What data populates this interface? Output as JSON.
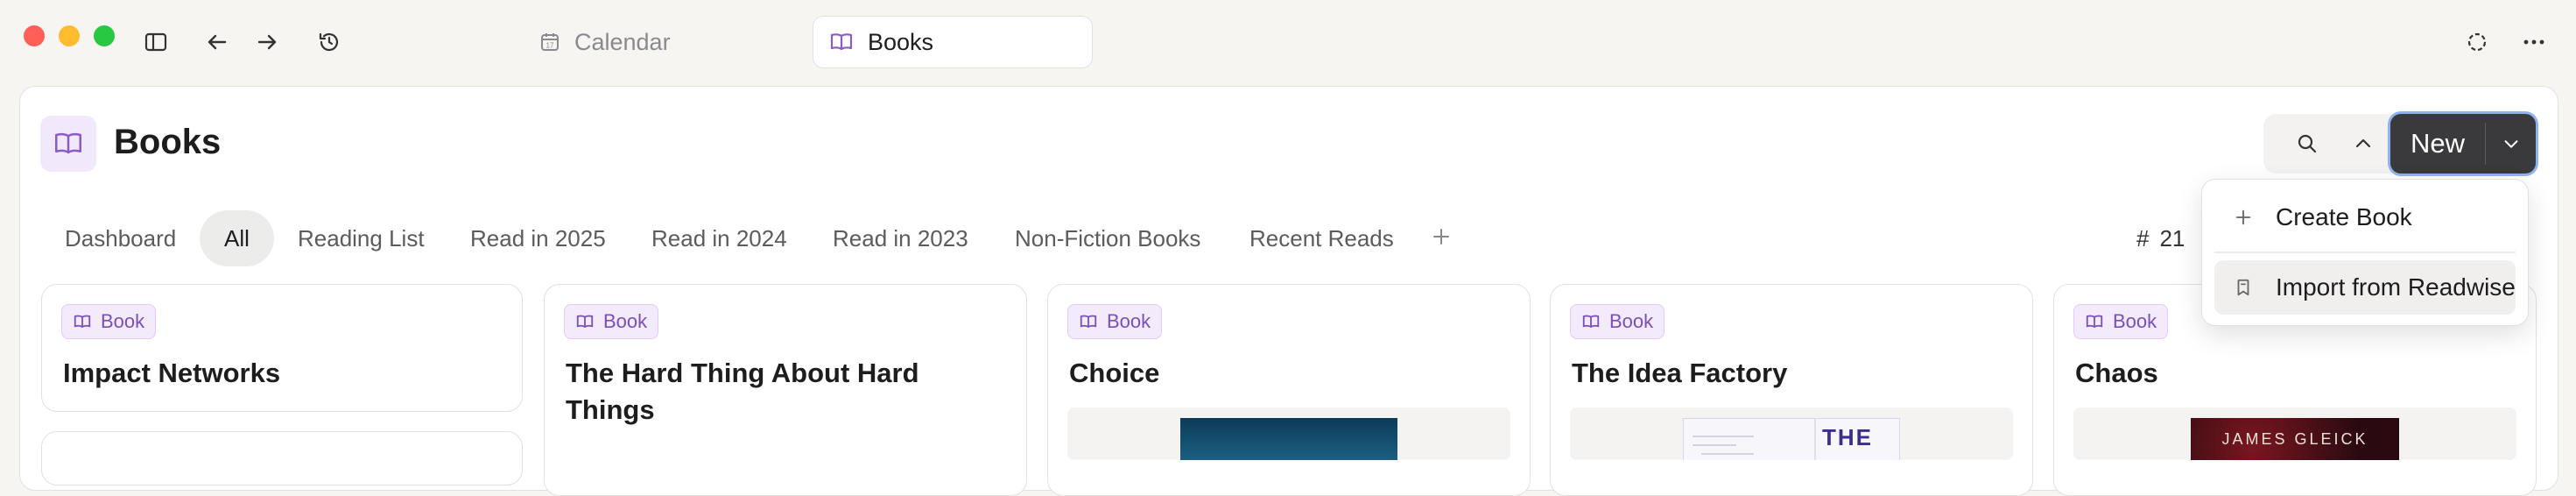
{
  "window": {
    "traffic_colors": [
      "#ff5f57",
      "#febc2e",
      "#28c840"
    ]
  },
  "toolbar": {
    "icons": [
      "sidebar-toggle-icon",
      "back-arrow-icon",
      "forward-arrow-icon",
      "history-icon"
    ],
    "right_icons": [
      "sync-status-icon",
      "more-options-icon"
    ]
  },
  "tabs": [
    {
      "label": "Calendar",
      "icon": "calendar-icon",
      "active": false
    },
    {
      "label": "Books",
      "icon": "book-icon",
      "active": true
    }
  ],
  "page": {
    "title": "Books",
    "icon": "book-icon",
    "accent": "#8a5cc4"
  },
  "actions": {
    "new_label": "New",
    "icons": [
      "search-icon",
      "chevron-up-icon",
      "chevron-down-icon"
    ]
  },
  "views": [
    {
      "label": "Dashboard",
      "active": false
    },
    {
      "label": "All",
      "active": true
    },
    {
      "label": "Reading List",
      "active": false
    },
    {
      "label": "Read in 2025",
      "active": false
    },
    {
      "label": "Read in 2024",
      "active": false
    },
    {
      "label": "Read in 2023",
      "active": false
    },
    {
      "label": "Non-Fiction Books",
      "active": false
    },
    {
      "label": "Recent Reads",
      "active": false
    }
  ],
  "count": {
    "symbol": "#",
    "value": "21"
  },
  "cards": [
    {
      "badge": "Book",
      "title": "Impact Networks",
      "has_cover": false
    },
    {
      "badge": "Book",
      "title": "The Hard Thing About Hard Things",
      "has_cover": false
    },
    {
      "badge": "Book",
      "title": "Choice",
      "has_cover": true
    },
    {
      "badge": "Book",
      "title": "The Idea Factory",
      "has_cover": true
    },
    {
      "badge": "Book",
      "title": "Chaos",
      "has_cover": true
    }
  ],
  "cover_texts": {
    "idea_factory": "THE",
    "chaos": "JAMES GLEICK"
  },
  "dropdown": {
    "items": [
      {
        "label": "Create Book",
        "icon": "plus-icon",
        "highlighted": false
      },
      {
        "label": "Import from Readwise",
        "icon": "bookmark-icon",
        "highlighted": true
      }
    ]
  }
}
